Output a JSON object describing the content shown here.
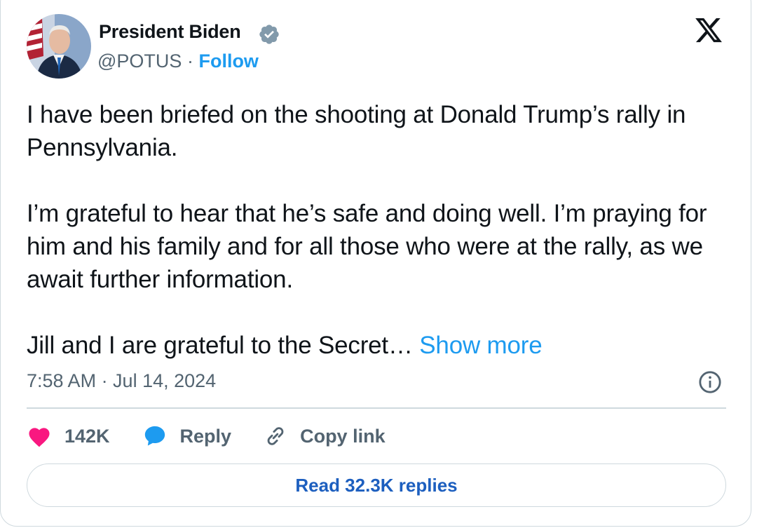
{
  "author": {
    "name": "President Biden",
    "handle": "@POTUS",
    "separator": "·",
    "follow_label": "Follow"
  },
  "tweet": {
    "text": "I have been briefed on the shooting at Donald Trump’s rally in Pennsylvania.\n\nI’m grateful to hear that he’s safe and doing well. I’m praying for him and his family and for all those who were at the rally, as we await further information.\n\nJill and I are grateful to the Secret…",
    "show_more_label": "Show more",
    "timestamp": "7:58 AM · Jul 14, 2024"
  },
  "actions": {
    "like_count": "142K",
    "reply_label": "Reply",
    "copy_link_label": "Copy link"
  },
  "read_replies_label": "Read 32.3K replies",
  "colors": {
    "accent": "#1d9bf0",
    "like": "#f91880",
    "muted": "#536471",
    "border": "#cfd9de"
  },
  "icons": [
    "avatar",
    "verified-badge-icon",
    "x-logo-icon",
    "info-icon",
    "heart-icon",
    "reply-bubble-icon",
    "link-icon"
  ]
}
